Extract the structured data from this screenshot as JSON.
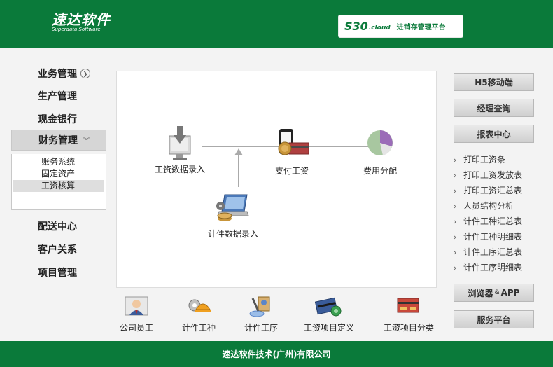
{
  "header": {
    "logo_cn": "速达软件",
    "logo_en": "Superdata Software",
    "platform_code": "S30",
    "platform_cloud": ".cloud",
    "platform_title": "进销存管理平台"
  },
  "left_menu": {
    "items": [
      {
        "label": "业务管理"
      },
      {
        "label": "生产管理"
      },
      {
        "label": "现金银行"
      },
      {
        "label": "财务管理"
      },
      {
        "label": "配送中心"
      },
      {
        "label": "客户关系"
      },
      {
        "label": "项目管理"
      }
    ],
    "submenu": [
      {
        "label": "账务系统"
      },
      {
        "label": "固定资产"
      },
      {
        "label": "工资核算"
      }
    ]
  },
  "flow": {
    "wage_entry": "工资数据录入",
    "payment": "支付工资",
    "allocation": "费用分配",
    "piece_entry": "计件数据录入"
  },
  "bottom_icons": [
    {
      "label": "公司员工"
    },
    {
      "label": "计件工种"
    },
    {
      "label": "计件工序"
    },
    {
      "label": "工资项目定义"
    },
    {
      "label": "工资项目分类"
    }
  ],
  "right_panel": {
    "h5": "H5移动端",
    "manager": "经理查询",
    "report_center": "报表中心",
    "reports": [
      "打印工资条",
      "打印工资发放表",
      "打印工资汇总表",
      "人员结构分析",
      "计件工种汇总表",
      "计件工种明细表",
      "计件工序汇总表",
      "计件工序明细表"
    ],
    "browser_a": "浏览器",
    "browser_amp": "&",
    "browser_b": "APP",
    "service": "服务平台"
  },
  "footer": {
    "text": "速达软件技术(广州)有限公司"
  },
  "colors": {
    "brand_green": "#0a7a3a",
    "panel_white": "#ffffff",
    "menu_active": "#d6d6d6"
  }
}
